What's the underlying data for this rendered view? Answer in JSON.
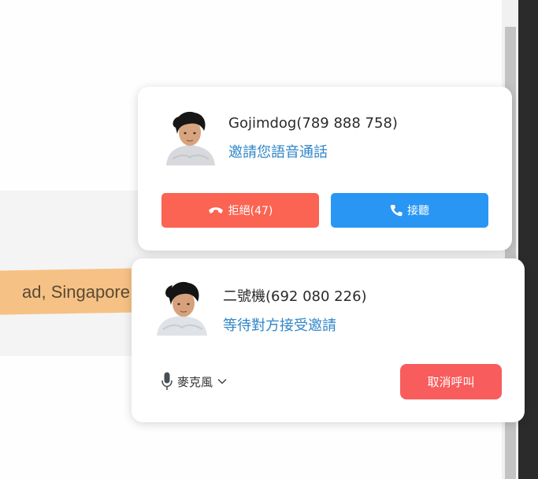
{
  "background": {
    "address_fragment": "ad, Singapore"
  },
  "incoming_call": {
    "caller": "Gojimdog(789 888 758)",
    "status": "邀請您語音通話",
    "reject_label": "拒絕(47)",
    "accept_label": "接聽",
    "reject_icon": "phone-hangup-icon",
    "accept_icon": "phone-icon"
  },
  "outgoing_call": {
    "callee": "二號機(692 080 226)",
    "status": "等待對方接受邀請",
    "microphone_label": "麥克風",
    "microphone_icon": "microphone-icon",
    "cancel_label": "取消呼叫"
  },
  "colors": {
    "reject": "#fb6352",
    "accept": "#2996f3",
    "cancel": "#f95c5c",
    "status_text": "#2f86c8"
  }
}
